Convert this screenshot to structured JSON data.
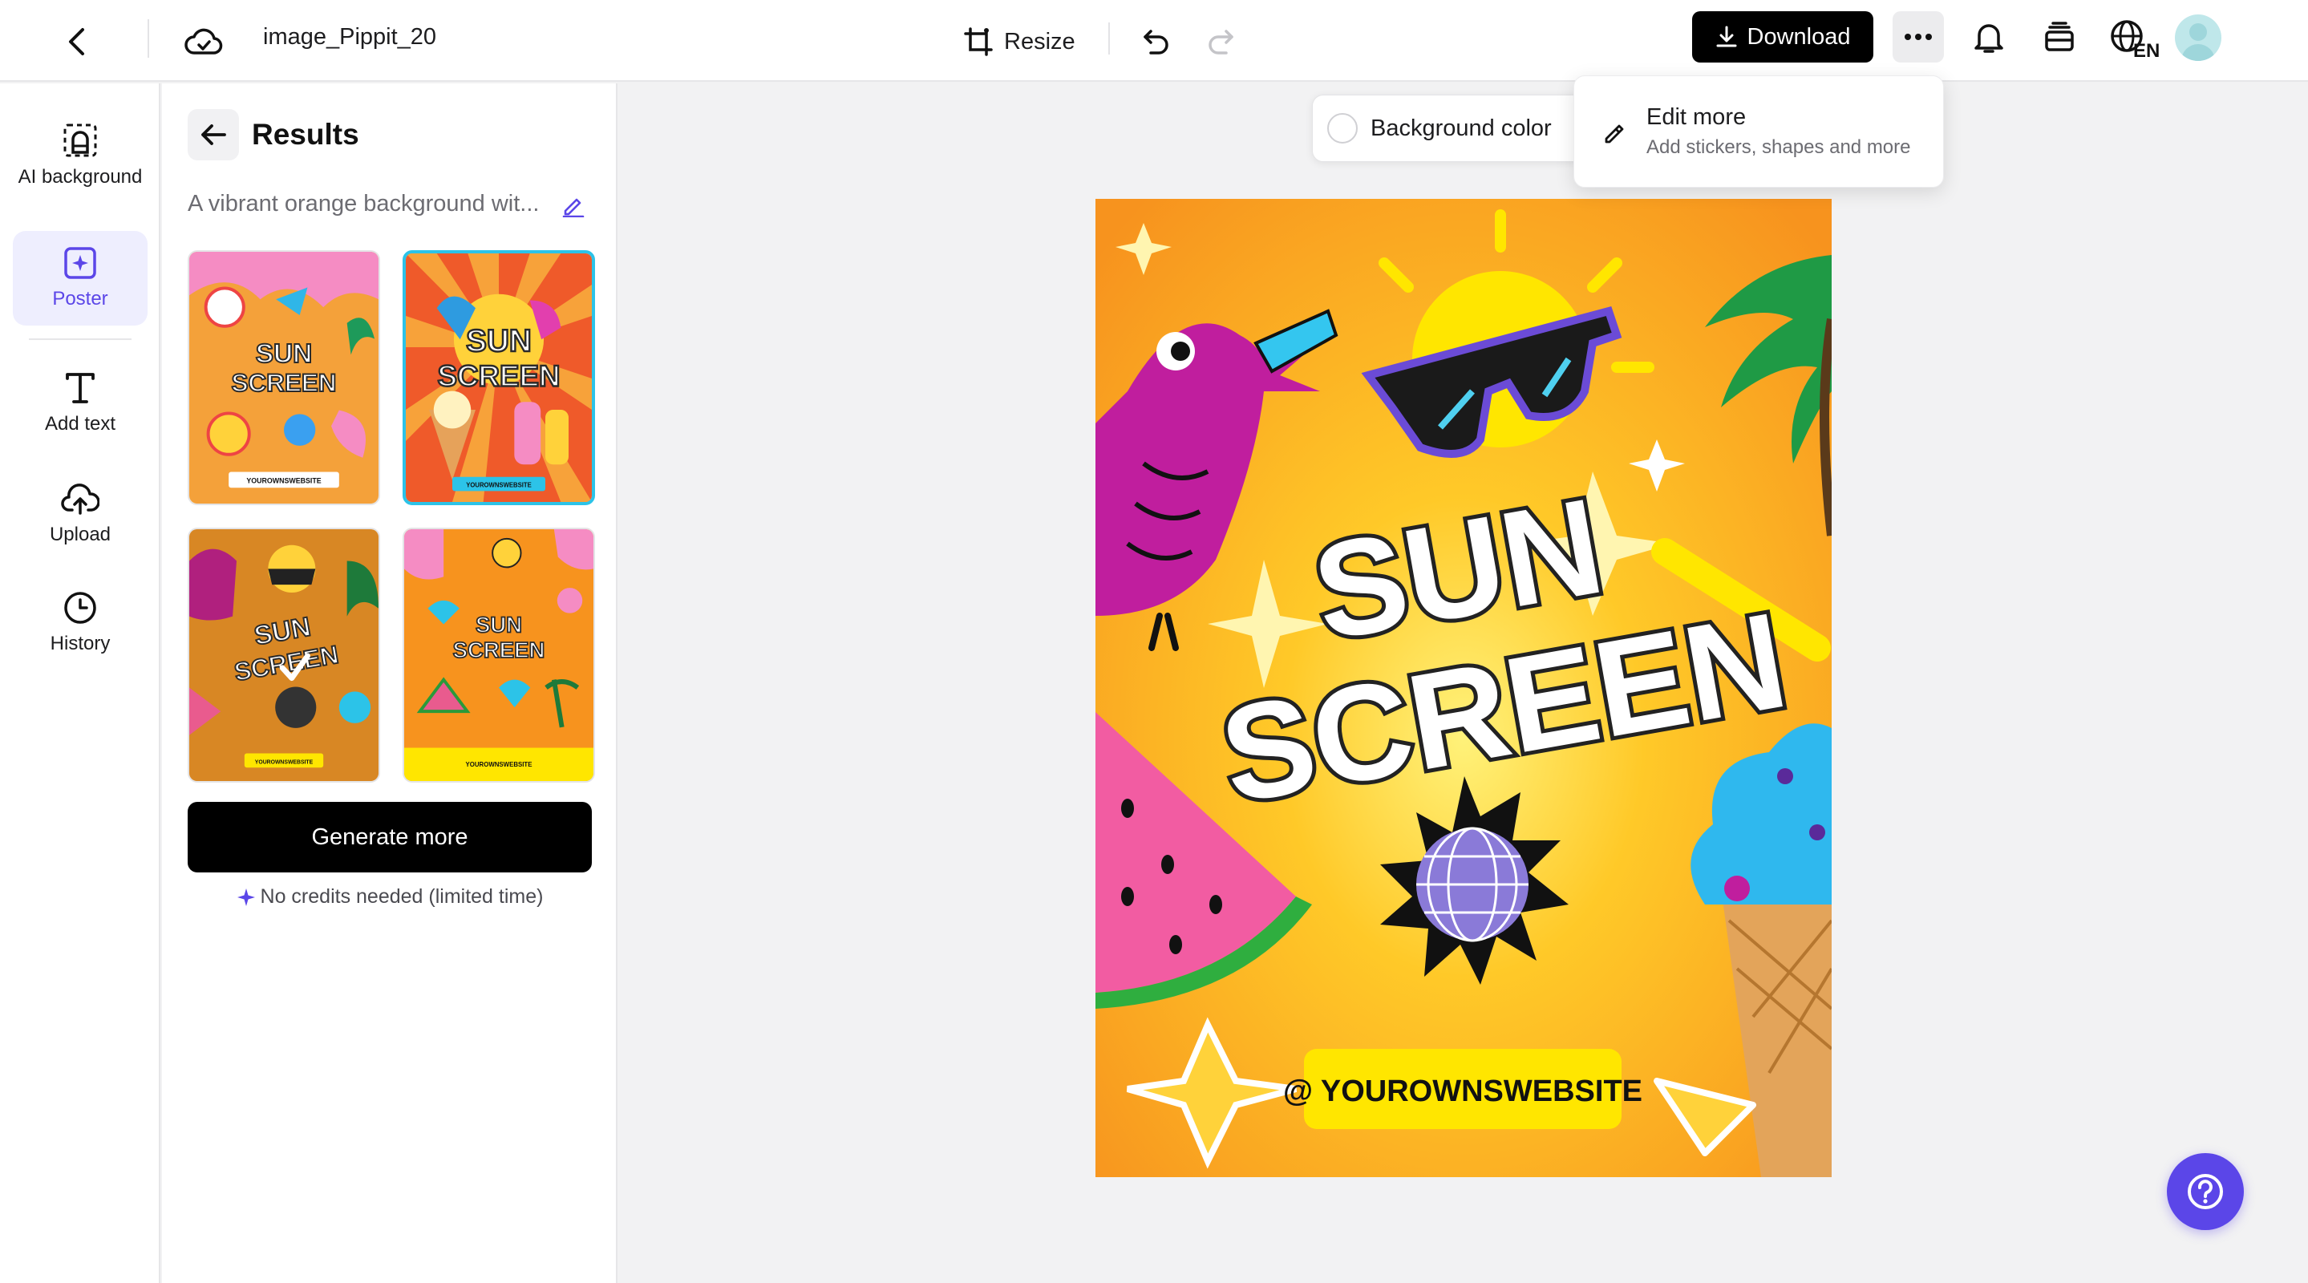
{
  "header": {
    "project_title": "image_Pippit_20",
    "resize_label": "Resize",
    "download_label": "Download",
    "language": "EN"
  },
  "sidebar": {
    "items": [
      {
        "label": "AI background",
        "icon": "ai-background-icon"
      },
      {
        "label": "Poster",
        "icon": "poster-icon",
        "active": true
      },
      {
        "label": "Add text",
        "icon": "text-icon"
      },
      {
        "label": "Upload",
        "icon": "upload-icon"
      },
      {
        "label": "History",
        "icon": "history-icon"
      }
    ]
  },
  "results": {
    "title": "Results",
    "prompt": "A vibrant orange background wit...",
    "thumbnails": [
      {
        "headline_1": "SUN",
        "headline_2": "SCREEN",
        "footer": "YOUROWNSWEBSITE"
      },
      {
        "headline_1": "SUN",
        "headline_2": "SCREEN",
        "footer": "YOUROWNSWEBSITE"
      },
      {
        "headline_1": "SUN",
        "headline_2": "SCREEN",
        "footer": "YOUROWNSWEBSITE"
      },
      {
        "headline_1": "SUN",
        "headline_2": "SCREEN",
        "footer": "YOUROWNSWEBSITE"
      }
    ],
    "generate_label": "Generate more",
    "credits_note": "No credits needed (limited time)"
  },
  "canvas": {
    "background_color_label": "Background color",
    "poster": {
      "headline_1": "SUN",
      "headline_2": "SCREEN",
      "footer": "@ YOUROWNSWEBSITE"
    }
  },
  "dropdown": {
    "title": "Edit more",
    "subtitle": "Add stickers, shapes and more"
  },
  "colors": {
    "accent": "#5b46e8",
    "poster_orange": "#f7931e",
    "poster_yellow": "#ffe600"
  }
}
